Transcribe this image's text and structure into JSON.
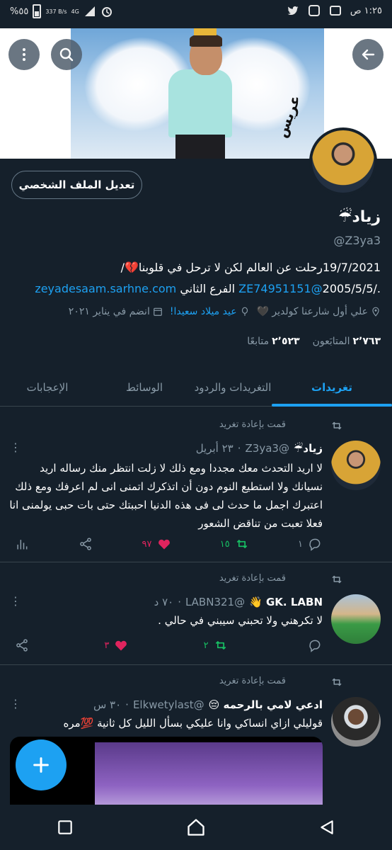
{
  "status_bar": {
    "time": "١:٢٥ ص",
    "battery": "%٥٥",
    "network": "4G",
    "speed": "337 B/s"
  },
  "header": {
    "banner_text": "عريس"
  },
  "profile": {
    "edit_button": "تعديل الملف الشخصي",
    "name": "زياد☔",
    "handle": "@Z3ya3",
    "bio_line1": "19/7/2021رحلت عن العالم لكن لا ترحل في قلوبنا💔/",
    "bio_line2_link": "zeyadesaam.sarhne.com",
    "bio_line2_mention": "@ZE74951151",
    "bio_line2_text_a": "الفرع الثاني",
    "bio_line2_text_b": "./2005/5/5",
    "location": "علي أول شارعنا كولدير 🖤",
    "birthday": "عيد ميلاد سعيدا!",
    "joined": "انضم في يناير ٢٠٢١",
    "following_count": "٢٬٥٢٣",
    "following_label": "متابعًا",
    "followers_count": "٢٬٧٦٣",
    "followers_label": "المتابَعون"
  },
  "tabs": [
    {
      "label": "تغريدات",
      "active": true
    },
    {
      "label": "التغريدات والردود",
      "active": false
    },
    {
      "label": "الوسائط",
      "active": false
    },
    {
      "label": "الإعجابات",
      "active": false
    }
  ],
  "tweets": [
    {
      "retweeted_label": "قمت بإعادة تغريد",
      "name": "زياد☔",
      "handle": "@Z3ya3",
      "date": "٢٣ أبريل",
      "text": "لا اريد التحدث معك مجددا ومع ذلك لا زلت انتظر منك رساله اريد نسيانك ولا استطيع النوم دون أن اتذكرك اتمنى انى لم اعرفك ومع ذلك اعتبرك اجمل ما حدث لى فى هذه الدنيا احببتك حتى بات حبى يولمنى انا فعلا تعبت من تناقض الشعور",
      "replies": "١",
      "retweets": "١٥",
      "likes": "٩٧"
    },
    {
      "retweeted_label": "قمت بإعادة تغريد",
      "name": "GK. LABN 👋",
      "handle": "@LABN321",
      "date": "٧٠ د",
      "text": "لا تكرهني ولا تحبني سيبني في حالي .",
      "replies": "",
      "retweets": "٢",
      "likes": "٣"
    },
    {
      "retweeted_label": "قمت بإعادة تغريد",
      "name": "ادعي لامي بالرحمه 😔",
      "handle": "@Elkwetylast",
      "date": "٣٠ س",
      "text": "قوليلي ازاي انساكي وانا عليكي بسأل الليل كل ثانية 💯مره"
    }
  ],
  "colors": {
    "background": "#15202b",
    "accent": "#1da1f2",
    "retweet": "#17bf63",
    "like": "#e0245e",
    "muted": "#8899a6",
    "divider": "#38444d"
  }
}
